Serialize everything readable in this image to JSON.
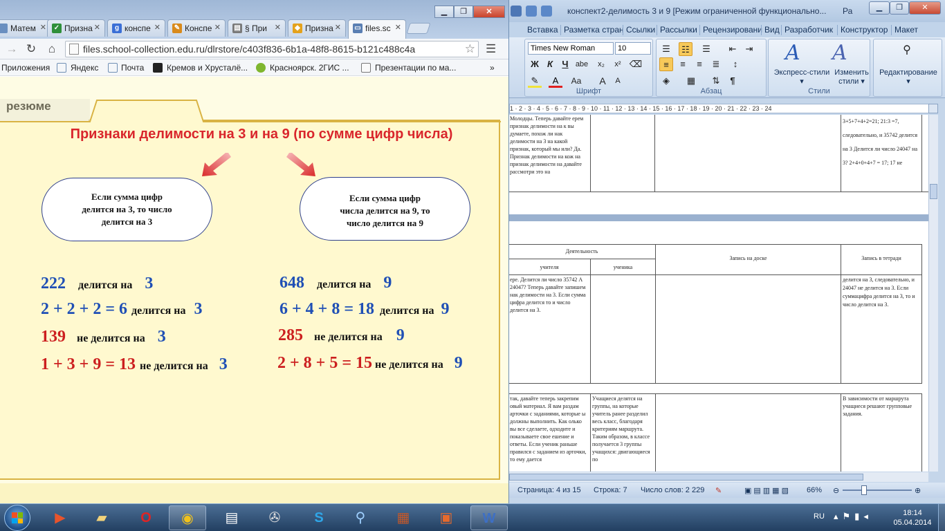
{
  "word": {
    "title": "конспект2-делимость 3 и 9 [Режим ограниченной функционально...",
    "title_extra": "Ра",
    "tabs": [
      "Вставка",
      "Разметка стран",
      "Ссылки",
      "Рассылки",
      "Рецензировани",
      "Вид",
      "Разработчик",
      "Конструктор",
      "Макет"
    ],
    "font_name": "Times New Roman",
    "font_size": "10",
    "groups": {
      "font": "Шрифт",
      "paragraph": "Абзац",
      "styles": "Стили"
    },
    "express_styles": [
      "Экспресс-стили"
    ],
    "change_styles": [
      "Изменить",
      "стили"
    ],
    "editing": "Редактирование",
    "ruler": "1 · 2 · 3 · 4 · 5 · 6 · 7 · 8 · 9 · 10 · 11 · 12 · 13 · 14 · 15 · 16 · 17 · 18 · 19 · 20 · 21 · 22 · 23 · 24",
    "doc": {
      "r1_left": "Молодцы. Теперь давайте ерем признак делимости на к вы думаете, похож ли нак делимости на 3 на какой признак, который мы или? Да. Признак делимости на кож на признак делимости на давайте рассмотри это на",
      "r1_right": "3+5+7+4+2=21; 21:3 =7, следовательно, и 35742 делится на 3 Делится ли число 24047 на 3? 2+4+0+4+7 = 17; 17 не",
      "h_activity": "Деятельность",
      "h_teacher": "учителя",
      "h_student": "ученика",
      "h_board": "Запись на доске",
      "h_notebook": "Запись в тетради",
      "r2_left": "ере. Делится ли число 35742 А 24047? Теперь давайте запишем нак делимости на 3. Если сумма цифра делится то и число делится на 3.",
      "r2_right": "делится на 3, следовательно, и 24047 не делится на 3. Если суммацифра делится на 3, то и число делится на 3.",
      "r3_left": "так, давайте теперь закрепим овый материал. Я вам раздам арточки с заданиями, которые ы должны выполнить. Как олько вы все сделаете, одходите и показываете свое ешение и ответы. Если ученик раньше правился с заданием из арточки, то ему дается",
      "r3_mid": "Учащиеся делятся на группы, на которые учитель ранее разделил весь класс, благодаря критериям маршрута. Таким образом, в классе получается 3 группы учащихся: двигающиеся по",
      "r3_right": "В зависимости от маршрута учащиеся решают групповые задания."
    },
    "status": {
      "page": "Страница: 4 из 15",
      "line": "Строка: 7",
      "words": "Число слов: 2 229",
      "zoom": "66%"
    },
    "zoom_level": 0.66
  },
  "chrome": {
    "tabs": [
      {
        "label": "Матем",
        "icon": "document-icon",
        "color": "#6a8fc0"
      },
      {
        "label": "Призна",
        "icon": "check-icon",
        "color": "#2f8f3a"
      },
      {
        "label": "конспе",
        "icon": "google-icon",
        "color": "#3b6fd6"
      },
      {
        "label": "Конспе",
        "icon": "pencil-icon",
        "color": "#d98a1b"
      },
      {
        "label": "§ При",
        "icon": "document-icon",
        "color": "#7a7a7a"
      },
      {
        "label": "Призна",
        "icon": "document-icon",
        "color": "#e4a21c"
      },
      {
        "label": "files.sc",
        "icon": "document-icon",
        "color": "#5a7fb3"
      }
    ],
    "url": "files.school-collection.edu.ru/dlrstore/c403f836-6b1a-48f8-8615-b121c488c4a",
    "bookmarks": [
      "Приложения",
      "Яндекс",
      "Почта",
      "Кремов и Хрусталё...",
      "Красноярск. 2ГИС ...",
      "Презентации по ма..."
    ],
    "more": "»"
  },
  "slide": {
    "section": "резюме",
    "title": "Признаки делимости на 3 и на 9 (по сумме цифр числа)",
    "rule3": [
      "Если сумма цифр",
      "делится на 3, то число",
      "делится на 3"
    ],
    "rule9": [
      "Если сумма цифр",
      "числа делится на 9, то",
      "число делится на 9"
    ],
    "examples_left": [
      {
        "expr": "222",
        "text": "делится на",
        "div": "3",
        "color": "blue"
      },
      {
        "expr": "2 + 2 + 2 = 6",
        "text": "делится на",
        "div": "3",
        "color": "blue"
      },
      {
        "expr": "139",
        "text": "не делится на",
        "div": "3",
        "color": "red"
      },
      {
        "expr": "1 + 3 + 9 = 13",
        "text": "не делится на",
        "div": "3",
        "color": "red"
      }
    ],
    "examples_right": [
      {
        "expr": "648",
        "text": "делится на",
        "div": "9",
        "color": "blue"
      },
      {
        "expr": "6 + 4 + 8 = 18",
        "text": "делится на",
        "div": "9",
        "color": "blue"
      },
      {
        "expr": "285",
        "text": "не делится на",
        "div": "9",
        "color": "red"
      },
      {
        "expr": "2 + 8 + 5 = 15",
        "text": "не делится на",
        "div": "9",
        "color": "red"
      }
    ]
  },
  "taskbar": {
    "apps": [
      "media-player-icon",
      "explorer-icon",
      "opera-icon",
      "chrome-icon",
      "notepad-icon",
      "film-icon",
      "skype-icon",
      "search-icon",
      "winrar-icon",
      "powerpoint-icon",
      "word-icon"
    ],
    "lang": "RU",
    "time": "18:14",
    "date": "05.04.2014"
  },
  "colors": {
    "accent_red": "#d9262c",
    "example_blue": "#1f4fb5",
    "example_red": "#cc1f1f",
    "frame": "#d9b343"
  }
}
